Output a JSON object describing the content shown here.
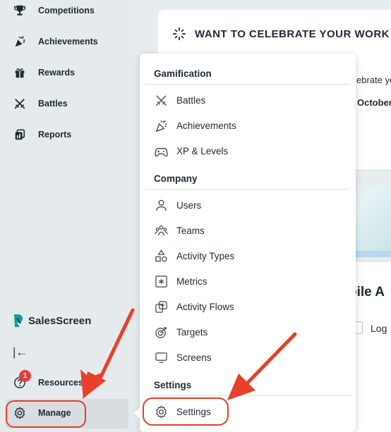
{
  "sidebar": {
    "items": [
      {
        "label": "Competitions",
        "icon": "trophy-icon"
      },
      {
        "label": "Achievements",
        "icon": "party-popper-icon"
      },
      {
        "label": "Rewards",
        "icon": "gift-icon"
      },
      {
        "label": "Battles",
        "icon": "crossed-swords-icon"
      },
      {
        "label": "Reports",
        "icon": "reports-icon"
      }
    ],
    "brand": "SalesScreen",
    "collapse_glyph": "|←",
    "resources_label": "Resources",
    "resources_badge": "1",
    "manage_label": "Manage"
  },
  "main": {
    "card_title": "WANT TO CELEBRATE YOUR WORK",
    "celebrate_text": "ebrate yo",
    "october_text": "October",
    "mobile_text": "bile A",
    "log_text": "Log"
  },
  "menu": {
    "gamification_heading": "Gamification",
    "gamification": [
      {
        "label": "Battles",
        "icon": "crossed-swords-icon"
      },
      {
        "label": "Achievements",
        "icon": "party-popper-icon"
      },
      {
        "label": "XP & Levels",
        "icon": "gamepad-icon"
      }
    ],
    "company_heading": "Company",
    "company": [
      {
        "label": "Users",
        "icon": "user-icon"
      },
      {
        "label": "Teams",
        "icon": "teams-icon"
      },
      {
        "label": "Activity Types",
        "icon": "shapes-icon"
      },
      {
        "label": "Metrics",
        "icon": "metrics-icon"
      },
      {
        "label": "Activity Flows",
        "icon": "activity-flows-icon"
      },
      {
        "label": "Targets",
        "icon": "target-icon"
      },
      {
        "label": "Screens",
        "icon": "screen-icon"
      }
    ],
    "settings_heading": "Settings",
    "settings": [
      {
        "label": "Settings",
        "icon": "gear-icon"
      }
    ]
  },
  "colors": {
    "sidebar_bg": "#e5eaec",
    "highlight_red": "#e2402a",
    "badge_red": "#e2403a",
    "brand_teal": "#1a9aa0"
  }
}
